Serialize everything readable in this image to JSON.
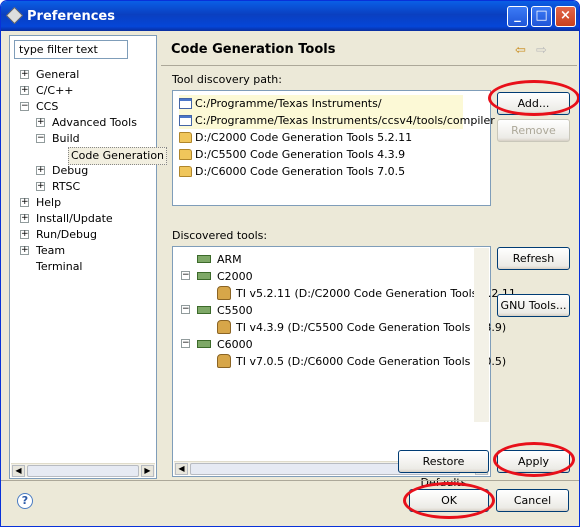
{
  "window": {
    "title": "Preferences"
  },
  "filter": {
    "placeholder": "type filter text"
  },
  "tree": [
    {
      "label": "General",
      "expander": "+"
    },
    {
      "label": "C/C++",
      "expander": "+"
    },
    {
      "label": "CCS",
      "expander": "−"
    },
    {
      "label": "Advanced Tools",
      "expander": "+"
    },
    {
      "label": "Build",
      "expander": "−"
    },
    {
      "label": "Code Generation",
      "expander": ""
    },
    {
      "label": "Debug",
      "expander": "+"
    },
    {
      "label": "RTSC",
      "expander": "+"
    },
    {
      "label": "Help",
      "expander": "+"
    },
    {
      "label": "Install/Update",
      "expander": "+"
    },
    {
      "label": "Run/Debug",
      "expander": "+"
    },
    {
      "label": "Team",
      "expander": "+"
    },
    {
      "label": "Terminal",
      "expander": ""
    }
  ],
  "page": {
    "title": "Code Generation Tools",
    "discovery_label": "Tool discovery path:",
    "discovered_label": "Discovered tools:"
  },
  "discovery_paths": [
    {
      "icon": "document-icon",
      "path": "C:/Programme/Texas Instruments/"
    },
    {
      "icon": "document-icon",
      "path": "C:/Programme/Texas Instruments/ccsv4/tools/compiler"
    },
    {
      "icon": "folder-icon",
      "path": "D:/C2000 Code Generation Tools 5.2.11"
    },
    {
      "icon": "folder-icon",
      "path": "D:/C5500 Code Generation Tools 4.3.9"
    },
    {
      "icon": "folder-icon",
      "path": "D:/C6000 Code Generation Tools 7.0.5"
    }
  ],
  "tools": [
    {
      "label": "ARM",
      "type": "family",
      "expander": ""
    },
    {
      "label": "C2000",
      "type": "family",
      "expander": "−"
    },
    {
      "label": "TI v5.2.11  (D:/C2000 Code Generation Tools 5.2.11",
      "type": "tool"
    },
    {
      "label": "C5500",
      "type": "family",
      "expander": "−"
    },
    {
      "label": "TI v4.3.9  (D:/C5500 Code Generation Tools 4.3.9)",
      "type": "tool"
    },
    {
      "label": "C6000",
      "type": "family",
      "expander": "−"
    },
    {
      "label": "TI v7.0.5  (D:/C6000 Code Generation Tools 7.0.5)",
      "type": "tool"
    }
  ],
  "buttons": {
    "add": "Add...",
    "remove": "Remove",
    "refresh": "Refresh",
    "gnu_tools": "GNU Tools...",
    "restore_defaults": "Restore Defaults",
    "apply": "Apply",
    "ok": "OK",
    "cancel": "Cancel"
  },
  "colors": {
    "highlight_ring": "#e8101a",
    "title_bar": "#0a3fc0"
  }
}
